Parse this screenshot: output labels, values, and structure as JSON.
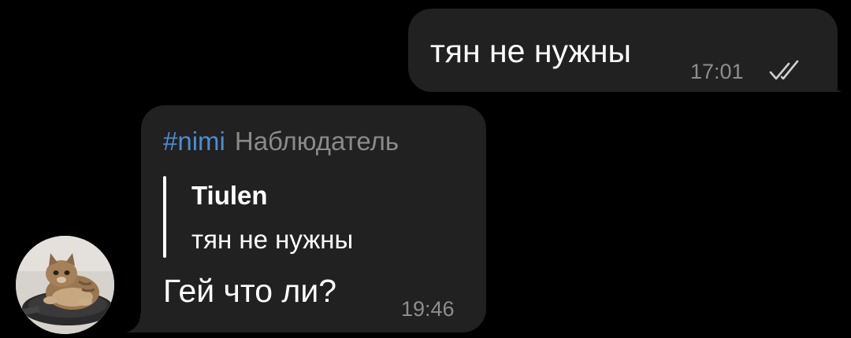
{
  "outgoing_message": {
    "text": "тян не нужны",
    "time": "17:01",
    "status_icon": "double-check-read-icon"
  },
  "incoming_message": {
    "sender": {
      "name": "#nimi",
      "title": "Наблюдатель"
    },
    "reply_to": {
      "author": "Tiulen",
      "text": "тян не нужны"
    },
    "text": "Гей что ли?",
    "time": "19:46",
    "avatar_icon": "cat-avatar"
  },
  "colors": {
    "background": "#000000",
    "bubble": "#212121",
    "sender_name": "#4d8dcf",
    "meta_text": "#8d8d8d"
  }
}
